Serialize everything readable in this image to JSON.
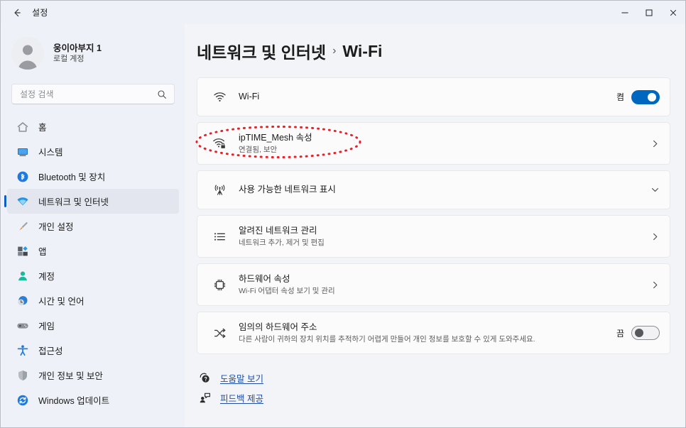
{
  "window": {
    "title": "설정",
    "back_icon": "back-arrow-icon",
    "controls": [
      {
        "name": "minimize-button",
        "icon": "minimize-icon"
      },
      {
        "name": "maximize-button",
        "icon": "maximize-icon"
      },
      {
        "name": "close-button",
        "icon": "close-icon"
      }
    ]
  },
  "sidebar": {
    "profile": {
      "name": "웅이아부지 1",
      "subtitle": "로컬 계정",
      "avatar_icon": "person-avatar-icon"
    },
    "search": {
      "placeholder": "설정 검색",
      "value": "",
      "icon": "search-icon"
    },
    "items": [
      {
        "label": "홈",
        "icon": "home-icon",
        "selected": false
      },
      {
        "label": "시스템",
        "icon": "system-monitor-icon",
        "selected": false
      },
      {
        "label": "Bluetooth 및 장치",
        "icon": "bluetooth-icon",
        "selected": false
      },
      {
        "label": "네트워크 및 인터넷",
        "icon": "wifi-icon",
        "selected": true
      },
      {
        "label": "개인 설정",
        "icon": "brush-icon",
        "selected": false
      },
      {
        "label": "앱",
        "icon": "apps-icon",
        "selected": false
      },
      {
        "label": "계정",
        "icon": "account-person-icon",
        "selected": false
      },
      {
        "label": "시간 및 언어",
        "icon": "clock-globe-icon",
        "selected": false
      },
      {
        "label": "게임",
        "icon": "gamepad-icon",
        "selected": false
      },
      {
        "label": "접근성",
        "icon": "accessibility-icon",
        "selected": false
      },
      {
        "label": "개인 정보 및 보안",
        "icon": "shield-icon",
        "selected": false
      },
      {
        "label": "Windows 업데이트",
        "icon": "update-refresh-icon",
        "selected": false
      }
    ]
  },
  "main": {
    "breadcrumb": {
      "parent": "네트워크 및 인터넷",
      "separator": "›",
      "current": "Wi-Fi"
    },
    "rows": [
      {
        "name": "wifi-toggle-row",
        "icon": "wifi-signal-icon",
        "title": "Wi-Fi",
        "subtitle": "",
        "control": "toggle",
        "toggle_state": "on",
        "toggle_label": "켬"
      },
      {
        "name": "network-properties-row",
        "icon": "wifi-secure-icon",
        "title": "ipTIME_Mesh 속성",
        "subtitle": "연결됨, 보안",
        "control": "chevron-right",
        "annotated": true
      },
      {
        "name": "show-available-networks-row",
        "icon": "radio-tower-icon",
        "title": "사용 가능한 네트워크 표시",
        "subtitle": "",
        "control": "chevron-down"
      },
      {
        "name": "manage-known-networks-row",
        "icon": "list-icon",
        "title": "알려진 네트워크 관리",
        "subtitle": "네트워크 추가, 제거 및 편집",
        "control": "chevron-right"
      },
      {
        "name": "hardware-properties-row",
        "icon": "chip-icon",
        "title": "하드웨어 속성",
        "subtitle": "Wi-Fi 어댑터 속성 보기 및 관리",
        "control": "chevron-right"
      },
      {
        "name": "random-hardware-address-row",
        "icon": "shuffle-icon",
        "title": "임의의 하드웨어 주소",
        "subtitle": "다른 사람이 귀하의 장치 위치를 추적하기 어렵게 만들어 개인 정보를 보호할 수 있게 도와주세요.",
        "control": "toggle",
        "toggle_state": "off",
        "toggle_label": "끔"
      }
    ],
    "links": [
      {
        "label": "도움말 보기",
        "icon": "help-question-icon"
      },
      {
        "label": "피드백 제공",
        "icon": "feedback-person-icon"
      }
    ]
  },
  "annotation": {
    "shape": "dotted-ellipse",
    "color": "#e8202a",
    "target": "ipTIME_Mesh 속성"
  },
  "colors": {
    "accent": "#0067c0",
    "selected_indicator": "#0d5fc4",
    "page_bg": "#f3f4f8",
    "sidebar_bg": "#eef1f7",
    "card_bg": "#fbfbfb",
    "link": "#1f4fa8",
    "annotation": "#e8202a"
  }
}
